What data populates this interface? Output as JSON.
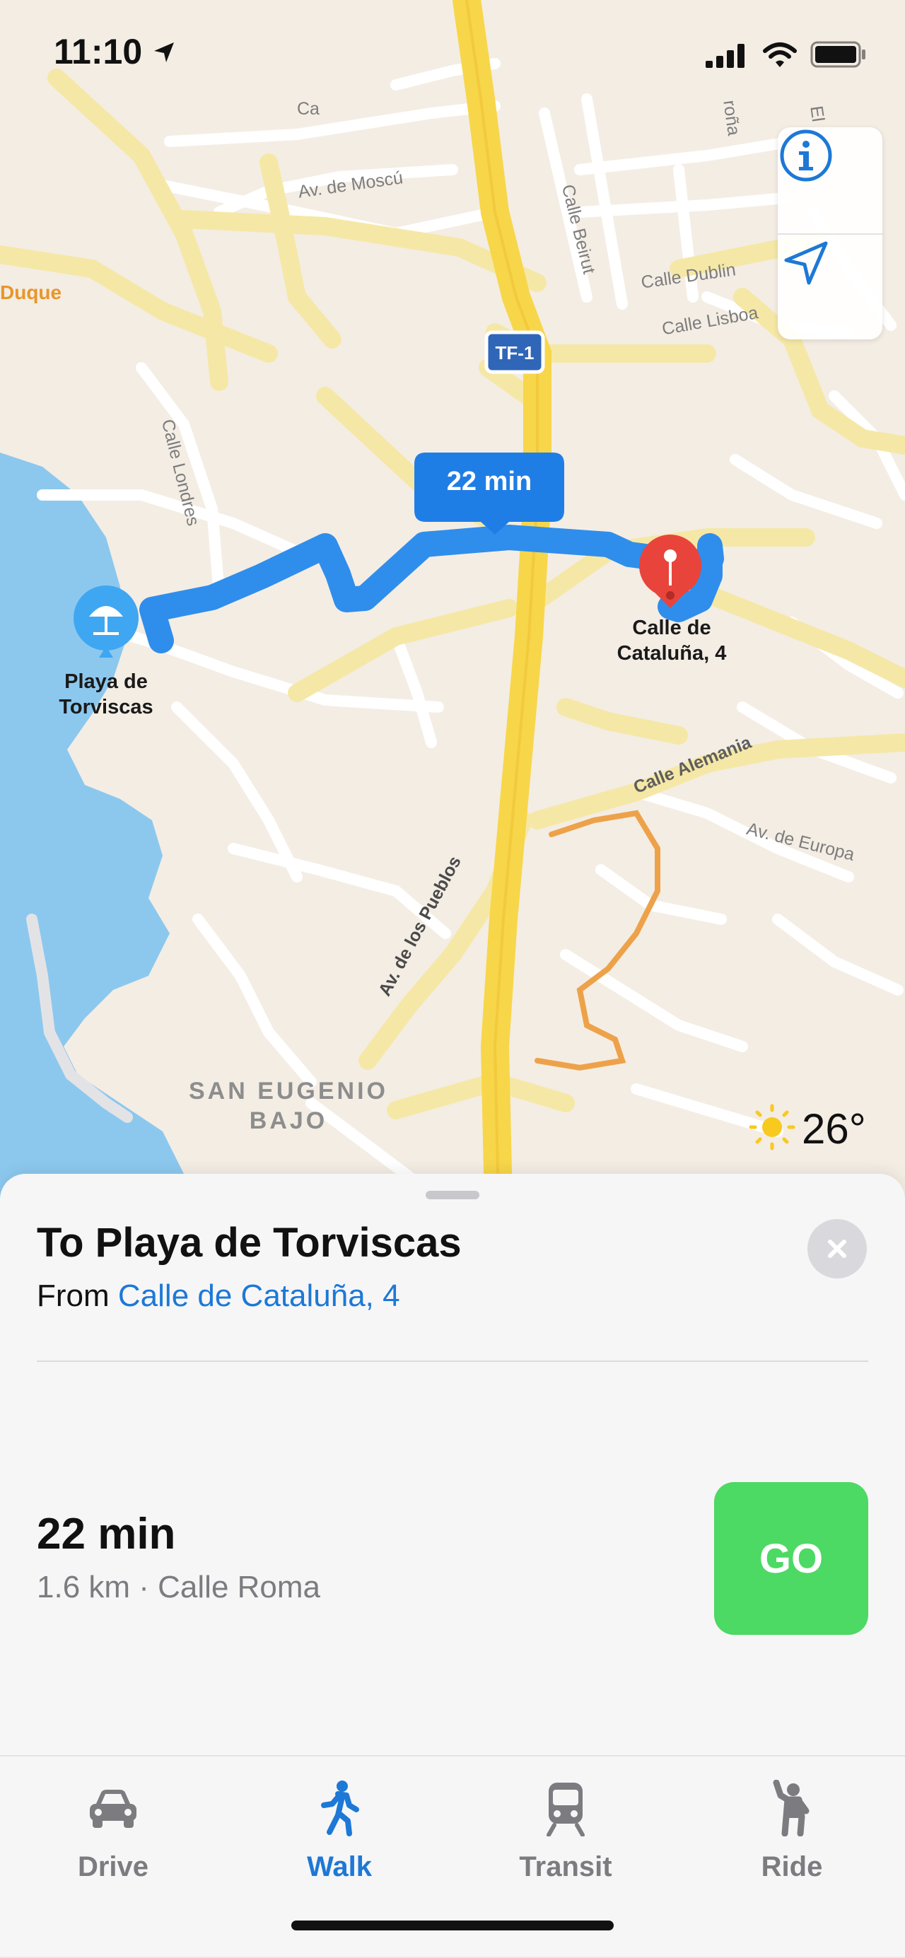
{
  "status": {
    "time": "11:10"
  },
  "map": {
    "route_badge": "22 min",
    "origin_pin_label_line1": "Calle de",
    "origin_pin_label_line2": "Cataluña, 4",
    "destination_label_line1": "Playa de",
    "destination_label_line2": "Torviscas",
    "highway_shield": "TF-1",
    "area_label_line1": "SAN EUGENIO",
    "area_label_line2": "BAJO",
    "poi_label": "Duque",
    "streets": {
      "av_moscu": "Av. de Moscú",
      "calle_beirut": "Calle Beirut",
      "calle_dublin": "Calle Dublin",
      "calle_lisboa": "Calle Lisboa",
      "calle_londres": "Calle Londres",
      "calle_alemania": "Calle Alemania",
      "av_europa": "Av. de Europa",
      "av_pueblos": "Av. de los Pueblos",
      "top_fragment_1": "Ca",
      "top_fragment_2": "roña",
      "top_fragment_3": "El"
    },
    "weather": {
      "icon": "sun-icon",
      "temperature": "26°"
    }
  },
  "sheet": {
    "title": "To Playa de Torviscas",
    "from_prefix": "From ",
    "from_place": "Calle de Cataluña, 4",
    "route_time": "22 min",
    "route_info": "1.6 km · Calle Roma",
    "go_label": "GO"
  },
  "tabs": [
    {
      "label": "Drive",
      "icon": "car-icon"
    },
    {
      "label": "Walk",
      "icon": "walking-icon",
      "active": true
    },
    {
      "label": "Transit",
      "icon": "train-icon"
    },
    {
      "label": "Ride",
      "icon": "rideshare-icon"
    }
  ],
  "colors": {
    "accent": "#1d78d6",
    "go": "#4cd964",
    "route": "#2f8eec",
    "highway": "#f7d64a",
    "water": "#8cc8ee",
    "pin": "#e8443c"
  }
}
